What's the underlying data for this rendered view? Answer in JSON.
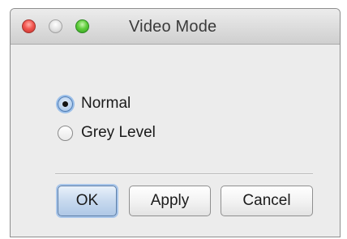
{
  "window": {
    "title": "Video Mode"
  },
  "video_mode": {
    "options": [
      {
        "label": "Normal",
        "selected": true
      },
      {
        "label": "Grey Level",
        "selected": false
      }
    ]
  },
  "buttons": {
    "ok_label": "OK",
    "apply_label": "Apply",
    "cancel_label": "Cancel"
  },
  "colors": {
    "close": "#f25650",
    "minimize": "#d8d8d8",
    "zoom": "#5fce3b",
    "selection_accent": "#9cc0ea"
  }
}
